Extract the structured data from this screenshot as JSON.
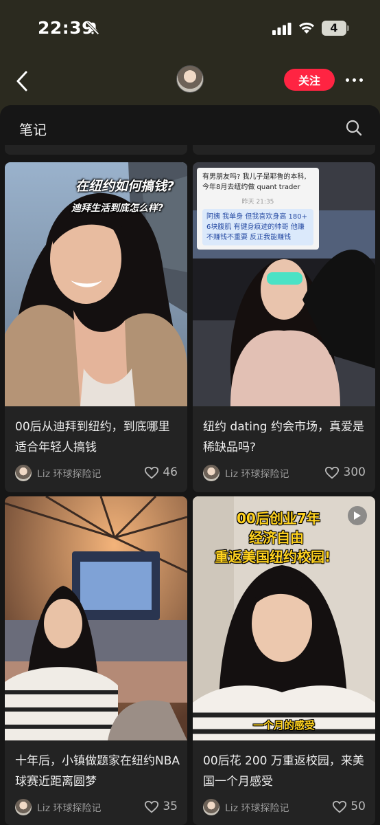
{
  "status_bar": {
    "time": "22:39",
    "battery": "4",
    "icons": [
      "bell-off-icon",
      "signal-icon",
      "wifi-icon",
      "battery-icon"
    ]
  },
  "nav": {
    "back_icon": "chevron-left-icon",
    "follow_label": "关注",
    "more_icon": "more-dots-icon",
    "accent": "#ff2442"
  },
  "section": {
    "title": "笔记",
    "search_icon": "search-icon"
  },
  "notes": [
    {
      "title": "00后从迪拜到纽约，到底哪里适合年轻人搞钱",
      "author": "Liz 环球探险记",
      "likes": "46",
      "overlay": [
        "在纽约如何搞钱?",
        "迪拜生活到底怎么样?"
      ]
    },
    {
      "title": "纽约 dating 约会市场，真爱是稀缺品吗?",
      "author": "Liz 环球探险记",
      "likes": "300",
      "chat": {
        "incoming": "有男朋友吗? 我儿子是耶鲁的本科, 今年8月去纽约做 quant trader",
        "time": "昨天 21:35",
        "outgoing": "阿姨 我单身 但我喜欢身高 180+ 6块腹肌 有健身痕迹的帅哥 他赚不赚钱不重要 反正我能赚钱"
      }
    },
    {
      "title": "十年后，小镇做题家在纽约NBA球赛近距离圆梦",
      "author": "Liz 环球探险记",
      "likes": "35"
    },
    {
      "title": "00后花 200 万重返校园，来美国一个月感受",
      "author": "Liz 环球探险记",
      "likes": "50",
      "overlay": [
        "00后创业7年",
        "经济自由",
        "重返美国纽约校园!",
        "一个月的感受"
      ],
      "video_icon": "play-icon"
    }
  ]
}
